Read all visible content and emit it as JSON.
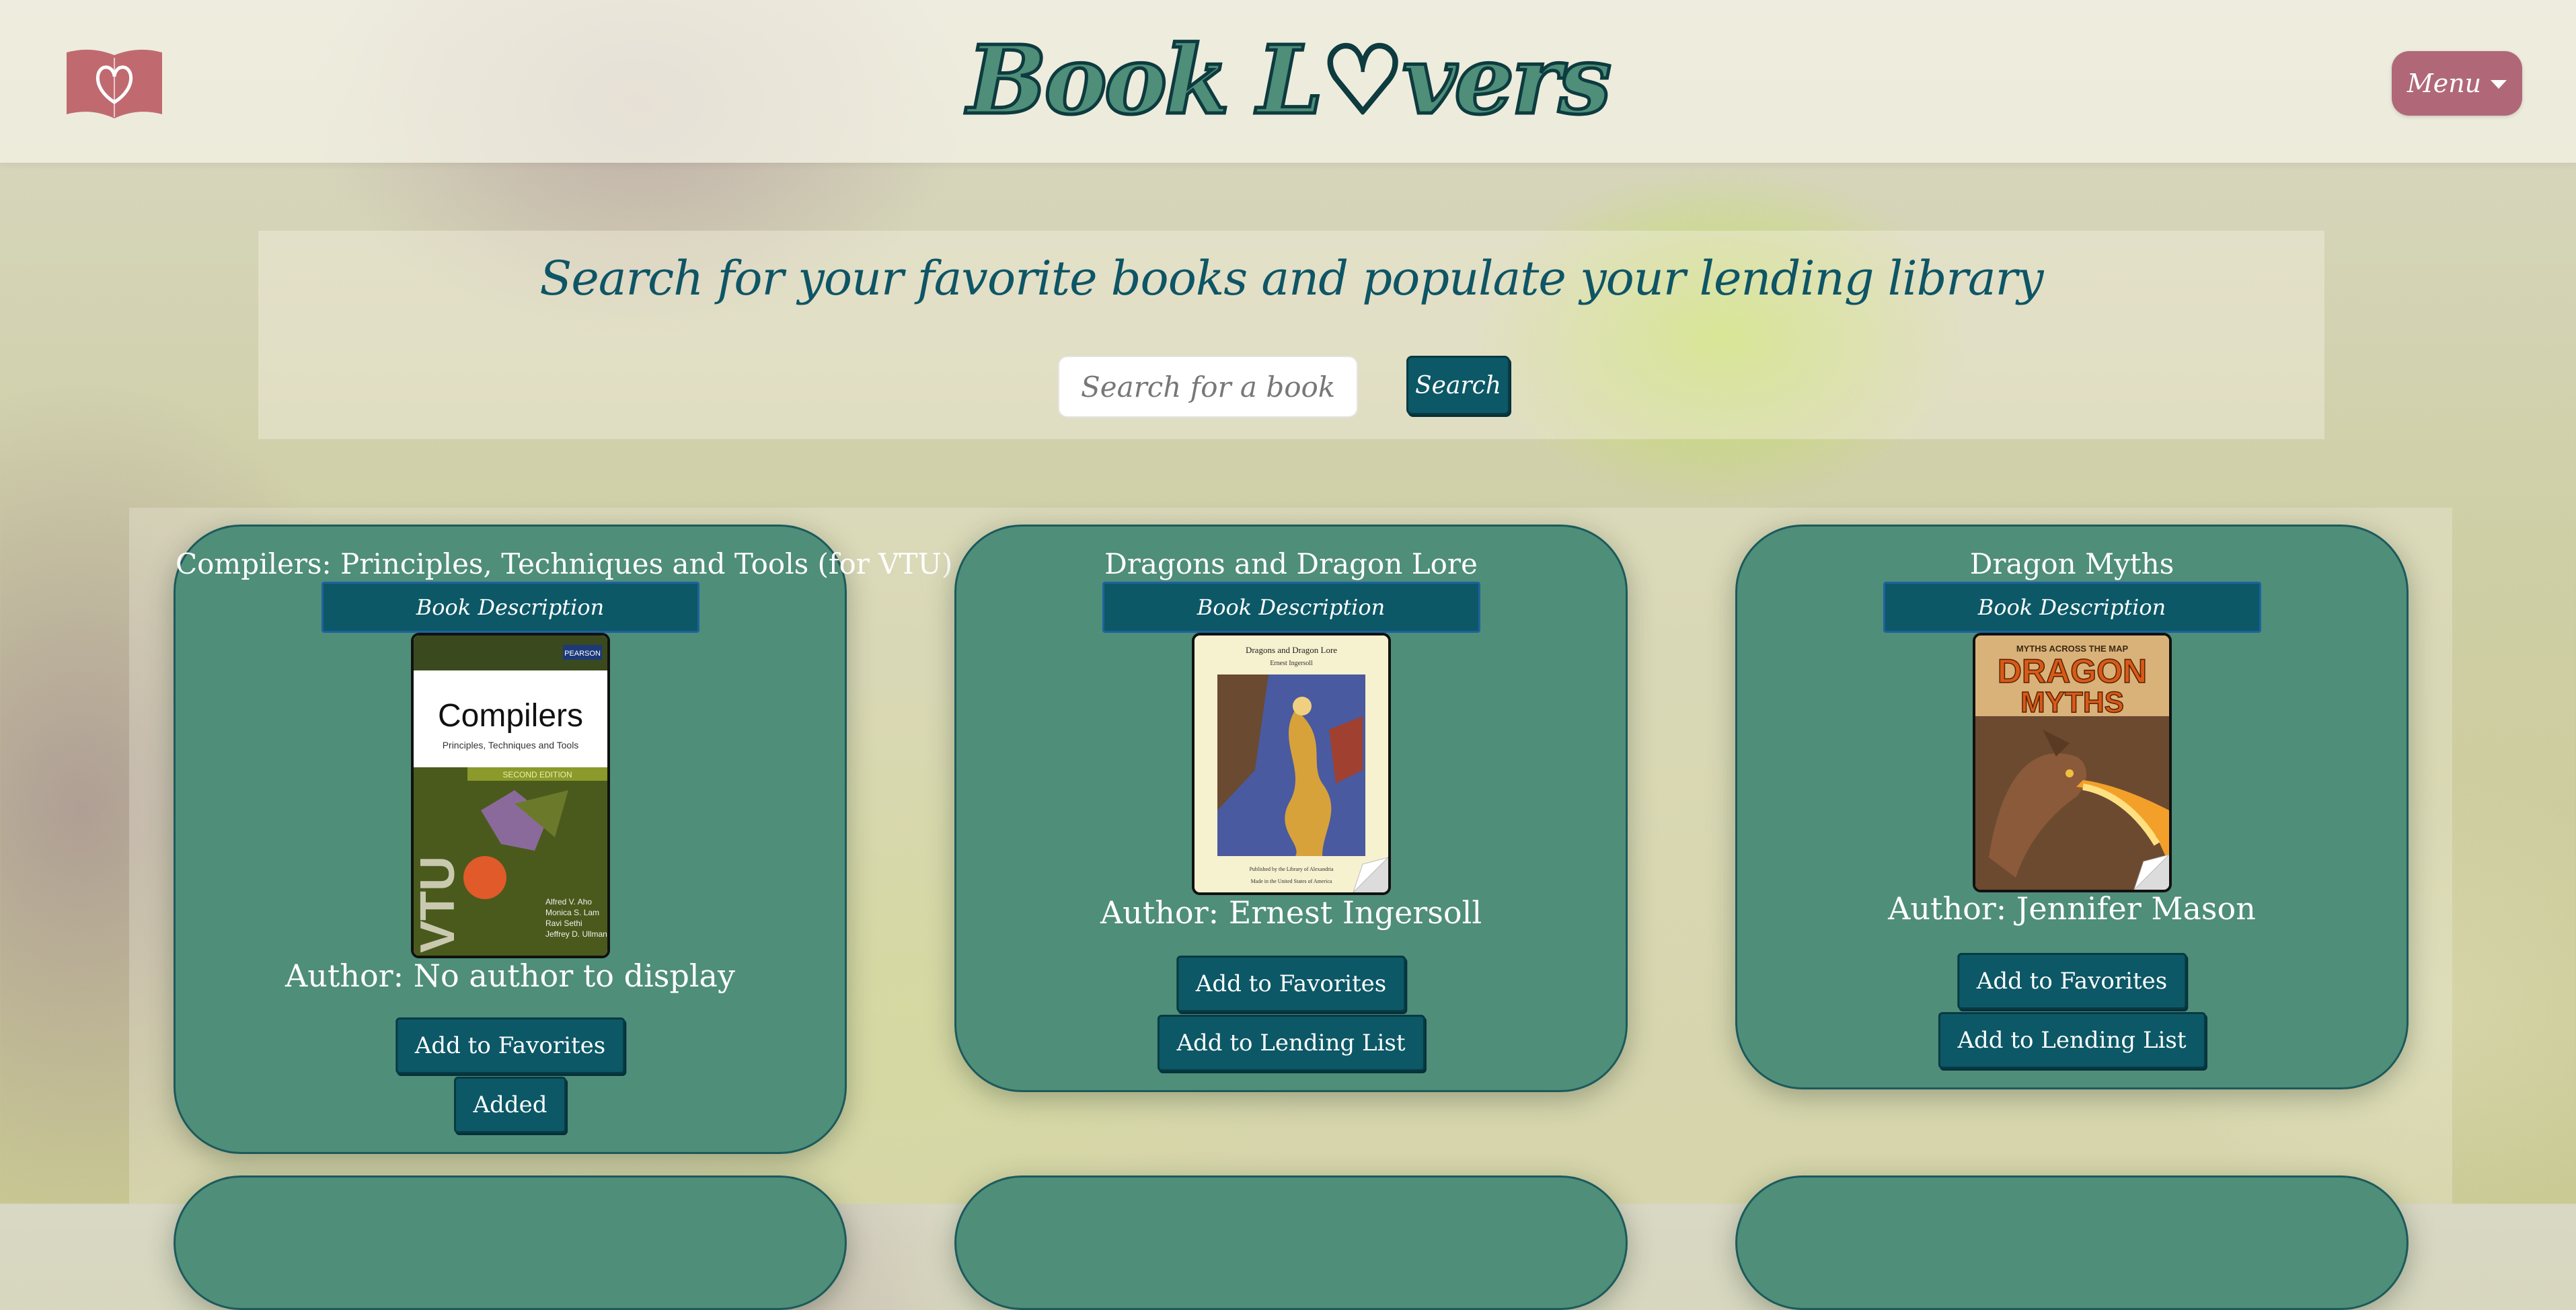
{
  "header": {
    "logo_icon": "book-heart-icon",
    "brand_text": "Book L♡vers",
    "menu_label": "Menu",
    "colors": {
      "brand_green": "#4f8e79",
      "brand_outline": "#0d3b3f",
      "menu_pink": "#b06878",
      "logo_pink": "#c06a70"
    }
  },
  "search": {
    "heading": "Search for your favorite books and populate your lending library",
    "placeholder": "Search for a book",
    "button_label": "Search",
    "colors": {
      "button_teal": "#0c5866"
    }
  },
  "results": [
    {
      "title": "Compilers: Principles, Techniques and Tools (for VTU)",
      "description_label": "Book Description",
      "cover": {
        "publisher": "PEARSON",
        "cover_title": "Compilers",
        "cover_subtitle": "Principles, Techniques and Tools",
        "edition": "SECOND EDITION",
        "spine_text": "VTU",
        "authors": [
          "Alfred V. Aho",
          "Monica S. Lam",
          "Ravi Sethi",
          "Jeffrey D. Ullman"
        ]
      },
      "author": "Author: No author to display",
      "favorites_label": "Add to Favorites",
      "lending_label": "Added"
    },
    {
      "title": "Dragons and Dragon Lore",
      "description_label": "Book Description",
      "cover": {
        "cover_title": "Dragons and Dragon Lore",
        "cover_author": "Ernest Ingersoll",
        "footer_1": "Published by the Library of Alexandria",
        "footer_2": "Made in the United States of America"
      },
      "author": "Author: Ernest Ingersoll",
      "favorites_label": "Add to Favorites",
      "lending_label": "Add to Lending List"
    },
    {
      "title": "Dragon Myths",
      "description_label": "Book Description",
      "cover": {
        "series": "MYTHS ACROSS THE MAP",
        "cover_title_1": "DRAGON",
        "cover_title_2": "MYTHS"
      },
      "author": "Author: Jennifer Mason",
      "favorites_label": "Add to Favorites",
      "lending_label": "Add to Lending List"
    }
  ]
}
